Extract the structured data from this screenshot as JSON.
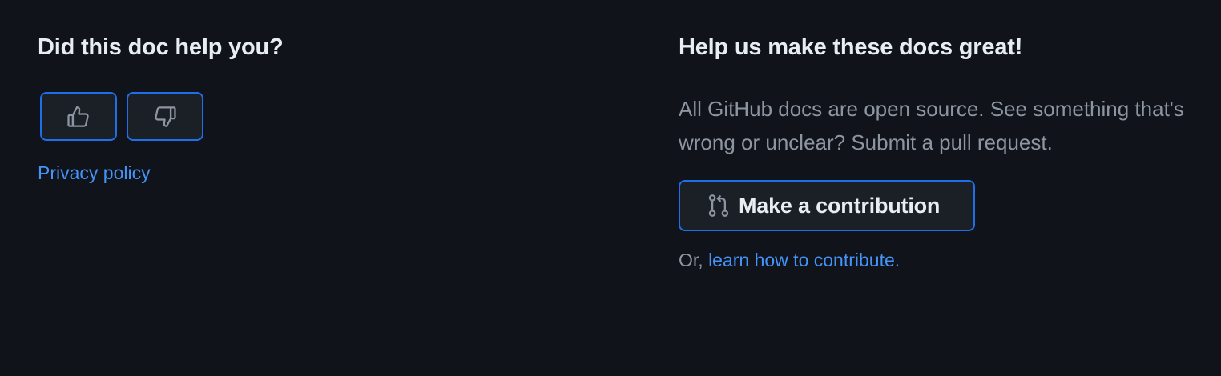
{
  "feedback": {
    "heading": "Did this doc help you?",
    "yes_icon": "thumbs-up-icon",
    "no_icon": "thumbs-down-icon",
    "privacy_link": "Privacy policy"
  },
  "contribute": {
    "heading": "Help us make these docs great!",
    "description": "All GitHub docs are open source. See something that's wrong or unclear? Submit a pull request.",
    "button_label": "Make a contribution",
    "button_icon": "git-pull-request-icon",
    "learn_prefix": "Or, ",
    "learn_link": "learn how to contribute."
  },
  "colors": {
    "background": "#10131a",
    "accent_border": "#1f6feb",
    "link": "#4493f8",
    "heading": "#e6edf3",
    "muted_text": "#8d96a0"
  }
}
